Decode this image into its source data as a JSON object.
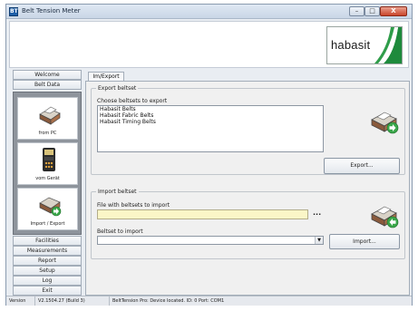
{
  "window": {
    "title": "Belt Tension Meter",
    "icon_letter": "BT",
    "buttons": {
      "minimize": "–",
      "maximize": "□",
      "close": "X"
    }
  },
  "banner": {
    "logo_text": "habasit",
    "logo_color": "#1e8a3c"
  },
  "sidebar": {
    "welcome": "Welcome",
    "belt_data": "Belt Data",
    "tiles": [
      {
        "label": "from PC",
        "icon": "printer-icon"
      },
      {
        "label": "vom Gerät",
        "icon": "device-icon"
      },
      {
        "label": "Import / Export",
        "icon": "printer-export-icon"
      }
    ],
    "bottom_items": [
      "Facilities",
      "Measurements",
      "Report",
      "Setup",
      "Log",
      "Exit"
    ]
  },
  "tabs": [
    {
      "label": "Im/Export",
      "active": true
    }
  ],
  "export": {
    "group_title": "Export beltset",
    "choose_label": "Choose beltsets to export",
    "items": [
      "Habasit Belts",
      "Habasit Fabric Belts",
      "Habasit Timing Belts"
    ],
    "button": "Export..."
  },
  "import": {
    "group_title": "Import beltset",
    "file_label": "File with beltsets to import",
    "file_value": "",
    "browse": "...",
    "beltset_label": "Beltset to import",
    "beltset_value": "",
    "button": "Import..."
  },
  "status": {
    "version_label": "Version",
    "version_value": "V2.1504.27  (Build 3)",
    "message": "BeltTension Pro: Device located. ID: 0  Port: COM1"
  }
}
